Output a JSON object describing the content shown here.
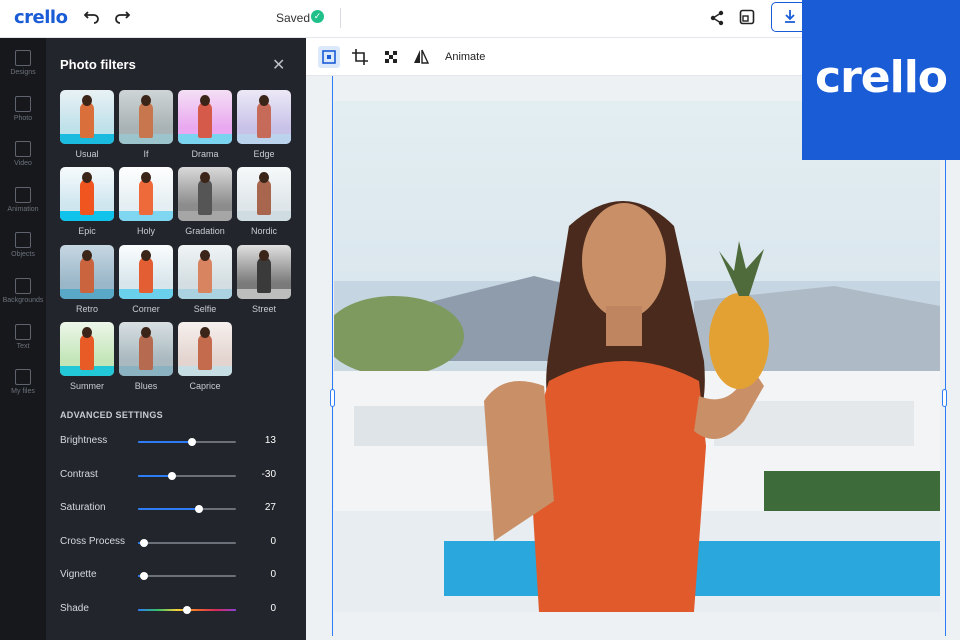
{
  "app": {
    "logo": "crello",
    "saved_label": "Saved",
    "brand_logo": "crello"
  },
  "topbar": {
    "undo_icon": "undo-icon",
    "redo_icon": "redo-icon",
    "share_icon": "share-icon",
    "resize_icon": "resize-icon",
    "download_icon": "download-icon"
  },
  "rail": [
    {
      "label": "Designs",
      "icon": "grid-icon"
    },
    {
      "label": "Photo",
      "icon": "image-icon"
    },
    {
      "label": "Video",
      "icon": "play-icon"
    },
    {
      "label": "Animation",
      "icon": "animation-icon"
    },
    {
      "label": "Objects",
      "icon": "shapes-icon"
    },
    {
      "label": "Backgrounds",
      "icon": "stripes-icon"
    },
    {
      "label": "Text",
      "icon": "text-icon"
    },
    {
      "label": "My files",
      "icon": "folder-icon"
    }
  ],
  "panel": {
    "title": "Photo filters",
    "filters": [
      {
        "label": "Usual"
      },
      {
        "label": "If"
      },
      {
        "label": "Drama"
      },
      {
        "label": "Edge"
      },
      {
        "label": "Epic"
      },
      {
        "label": "Holy"
      },
      {
        "label": "Gradation"
      },
      {
        "label": "Nordic"
      },
      {
        "label": "Retro"
      },
      {
        "label": "Corner"
      },
      {
        "label": "Selfie"
      },
      {
        "label": "Street"
      },
      {
        "label": "Summer"
      },
      {
        "label": "Blues"
      },
      {
        "label": "Caprice"
      }
    ],
    "advanced_title": "ADVANCED SETTINGS",
    "sliders": [
      {
        "label": "Brightness",
        "value": "13",
        "level": 0.55
      },
      {
        "label": "Contrast",
        "value": "-30",
        "level": 0.35
      },
      {
        "label": "Saturation",
        "value": "27",
        "level": 0.62
      },
      {
        "label": "Cross Process",
        "value": "0",
        "level": 0.06
      },
      {
        "label": "Vignette",
        "value": "0",
        "level": 0.06
      },
      {
        "label": "Shade",
        "value": "0",
        "level": 0.5
      }
    ]
  },
  "canvas_toolbar": {
    "animate_label": "Animate"
  },
  "colors": {
    "accent": "#1a5cd6",
    "panel_bg": "#22252b",
    "rail_bg": "#16181c",
    "slider_blue": "#2d7cf6",
    "saved_green": "#1fc08a"
  }
}
